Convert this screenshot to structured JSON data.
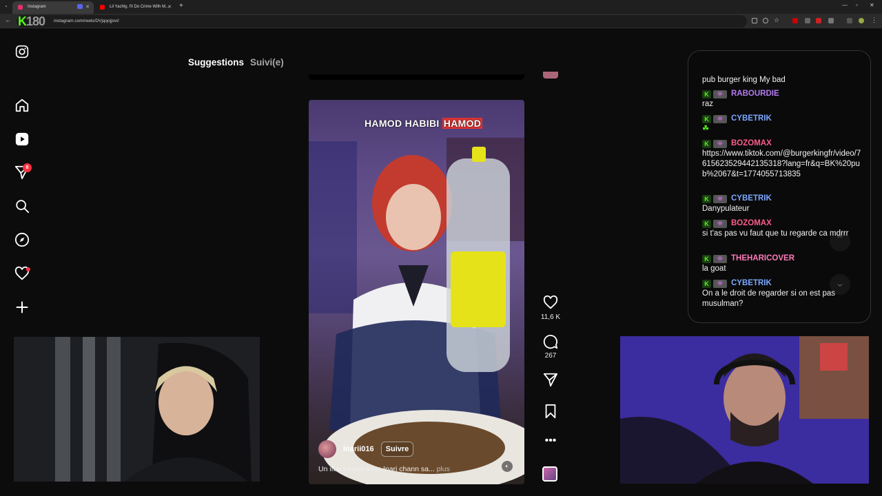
{
  "browser": {
    "tabs": [
      {
        "title": "Instagram",
        "active": true,
        "favicon_color": "#e1306c"
      },
      {
        "title": "Lil Yachty, I'll Do Crime With M...",
        "active": false,
        "favicon_color": "#ff0000"
      }
    ],
    "new_tab": "+",
    "url": "instagram.com/reels/DVjqqojjovi/",
    "overlay_logo": {
      "k": "K",
      "num": "180"
    }
  },
  "instagram": {
    "sidebar": {
      "notifications_badge": "8",
      "icons": [
        "instagram-logo-icon",
        "home-icon",
        "reels-icon",
        "messages-icon",
        "search-icon",
        "explore-icon",
        "heart-icon",
        "create-icon"
      ]
    },
    "feed_tabs": [
      {
        "label": "Suggestions",
        "active": true
      },
      {
        "label": "Suivi(e)",
        "active": false
      }
    ],
    "reel": {
      "overlay_title_plain": "HAMOD HABIBI ",
      "overlay_title_highlight": "HAMOD",
      "username": "inarii016",
      "follow_label": "Suivre",
      "description": "Un iftar kawaii avec Inari chann sa... ",
      "more_label": "plus",
      "likes": "11,6 K",
      "comments": "267"
    }
  },
  "chat": {
    "messages": [
      {
        "user": "",
        "color": "#ffffff",
        "text": "pub burger king My bad"
      },
      {
        "user": "RABOURDIE",
        "color": "#b57cf2",
        "text": "raz"
      },
      {
        "user": "CYBETRIK",
        "color": "#7aa8ff",
        "text": "☘"
      },
      {
        "user": "BOZOMAX",
        "color": "#ff5c8a",
        "text": "https://www.tiktok.com/@burgerkingfr/video/7615623529442135318?lang=fr&q=BK%20pub%2067&t=1774055713835"
      },
      {
        "user": "CYBETRIK",
        "color": "#7aa8ff",
        "text": "Danypulateur"
      },
      {
        "user": "BOZOMAX",
        "color": "#ff5c8a",
        "text": "si t'as pas vu faut que tu regarde ca mdrrr"
      },
      {
        "user": "THEHARICOVER",
        "color": "#ff7ab8",
        "text": "la goat"
      },
      {
        "user": "CYBETRIK",
        "color": "#7aa8ff",
        "text": "On a le droit de regarder si on est pas musulman?"
      }
    ]
  }
}
